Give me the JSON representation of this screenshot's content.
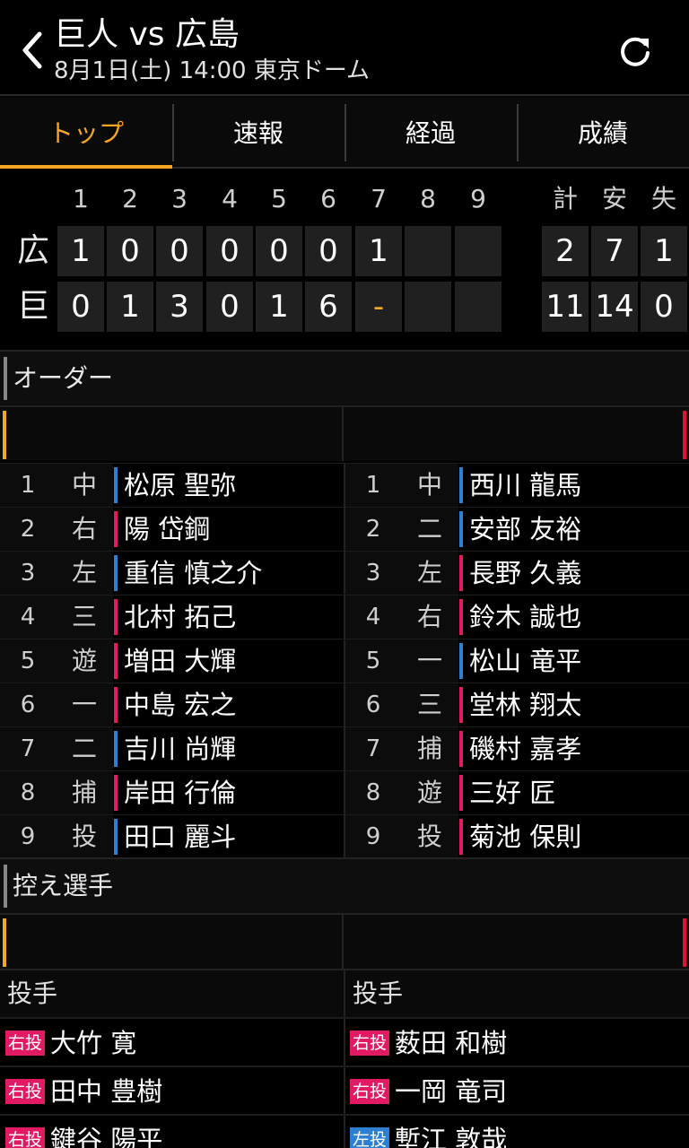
{
  "header": {
    "title": "巨人 vs 広島",
    "subtitle": "8月1日(土) 14:00 東京ドーム"
  },
  "tabs": [
    "トップ",
    "速報",
    "経過",
    "成績"
  ],
  "scoreboard": {
    "innings": [
      "1",
      "2",
      "3",
      "4",
      "5",
      "6",
      "7",
      "8",
      "9"
    ],
    "totals_headers": [
      "計",
      "安",
      "失"
    ],
    "rows": [
      {
        "team": "広",
        "innings": [
          "1",
          "0",
          "0",
          "0",
          "0",
          "0",
          "1",
          "",
          ""
        ],
        "totals": [
          "2",
          "7",
          "1"
        ]
      },
      {
        "team": "巨",
        "innings": [
          "0",
          "1",
          "3",
          "0",
          "1",
          "6",
          "-",
          "",
          ""
        ],
        "totals": [
          "11",
          "14",
          "0"
        ]
      }
    ]
  },
  "order_section": {
    "label": "オーダー"
  },
  "lineup": [
    {
      "left": {
        "num": "1",
        "pos": "中",
        "name": "松原 聖弥",
        "mark": "blue"
      },
      "right": {
        "num": "1",
        "pos": "中",
        "name": "西川 龍馬",
        "mark": "blue"
      }
    },
    {
      "left": {
        "num": "2",
        "pos": "右",
        "name": "陽 岱鋼",
        "mark": "pink"
      },
      "right": {
        "num": "2",
        "pos": "二",
        "name": "安部 友裕",
        "mark": "blue"
      }
    },
    {
      "left": {
        "num": "3",
        "pos": "左",
        "name": "重信 慎之介",
        "mark": "blue"
      },
      "right": {
        "num": "3",
        "pos": "左",
        "name": "長野 久義",
        "mark": "pink"
      }
    },
    {
      "left": {
        "num": "4",
        "pos": "三",
        "name": "北村 拓己",
        "mark": "pink"
      },
      "right": {
        "num": "4",
        "pos": "右",
        "name": "鈴木 誠也",
        "mark": "pink"
      }
    },
    {
      "left": {
        "num": "5",
        "pos": "遊",
        "name": "増田 大輝",
        "mark": "pink"
      },
      "right": {
        "num": "5",
        "pos": "一",
        "name": "松山 竜平",
        "mark": "blue"
      }
    },
    {
      "left": {
        "num": "6",
        "pos": "一",
        "name": "中島 宏之",
        "mark": "pink"
      },
      "right": {
        "num": "6",
        "pos": "三",
        "name": "堂林 翔太",
        "mark": "pink"
      }
    },
    {
      "left": {
        "num": "7",
        "pos": "二",
        "name": "吉川 尚輝",
        "mark": "blue"
      },
      "right": {
        "num": "7",
        "pos": "捕",
        "name": "磯村 嘉孝",
        "mark": "pink"
      }
    },
    {
      "left": {
        "num": "8",
        "pos": "捕",
        "name": "岸田 行倫",
        "mark": "pink"
      },
      "right": {
        "num": "8",
        "pos": "遊",
        "name": "三好 匠",
        "mark": "pink"
      }
    },
    {
      "left": {
        "num": "9",
        "pos": "投",
        "name": "田口 麗斗",
        "mark": "blue"
      },
      "right": {
        "num": "9",
        "pos": "投",
        "name": "菊池 保則",
        "mark": "pink"
      }
    }
  ],
  "bench_section": {
    "label": "控え選手"
  },
  "pitchers_header": {
    "left": "投手",
    "right": "投手"
  },
  "pitchers": [
    {
      "left": {
        "badge": "右投",
        "badge_color": "pink",
        "name": "大竹 寛"
      },
      "right": {
        "badge": "右投",
        "badge_color": "pink",
        "name": "薮田 和樹"
      }
    },
    {
      "left": {
        "badge": "右投",
        "badge_color": "pink",
        "name": "田中 豊樹"
      },
      "right": {
        "badge": "右投",
        "badge_color": "pink",
        "name": "一岡 竜司"
      }
    },
    {
      "left": {
        "badge": "右投",
        "badge_color": "pink",
        "name": "鍵谷 陽平"
      },
      "right": {
        "badge": "左投",
        "badge_color": "blue",
        "name": "塹江 敦哉"
      }
    }
  ],
  "colors": {
    "accent": "#f5a623",
    "blue": "#2d7fd1",
    "pink": "#e21a63",
    "red": "#e0103a"
  }
}
